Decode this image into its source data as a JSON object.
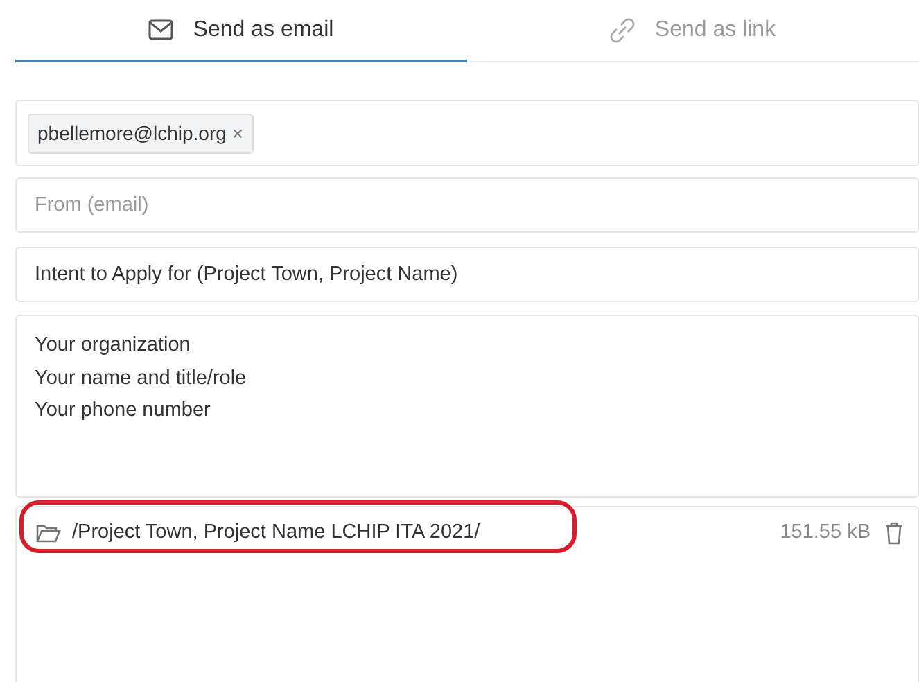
{
  "tabs": [
    {
      "label": "Send as email",
      "selected": true
    },
    {
      "label": "Send as link",
      "selected": false
    }
  ],
  "recipients": [
    {
      "address": "pbellemore@lchip.org",
      "remove": "×"
    }
  ],
  "from": {
    "placeholder": "From (email)"
  },
  "subject": {
    "value": "Intent to Apply for (Project Town, Project Name)"
  },
  "message": {
    "value": "Your organization\nYour name and title/role\nYour phone number"
  },
  "attachments": [
    {
      "path": "/Project Town, Project Name LCHIP ITA 2021/",
      "size": "151.55 kB",
      "highlighted": true
    }
  ]
}
